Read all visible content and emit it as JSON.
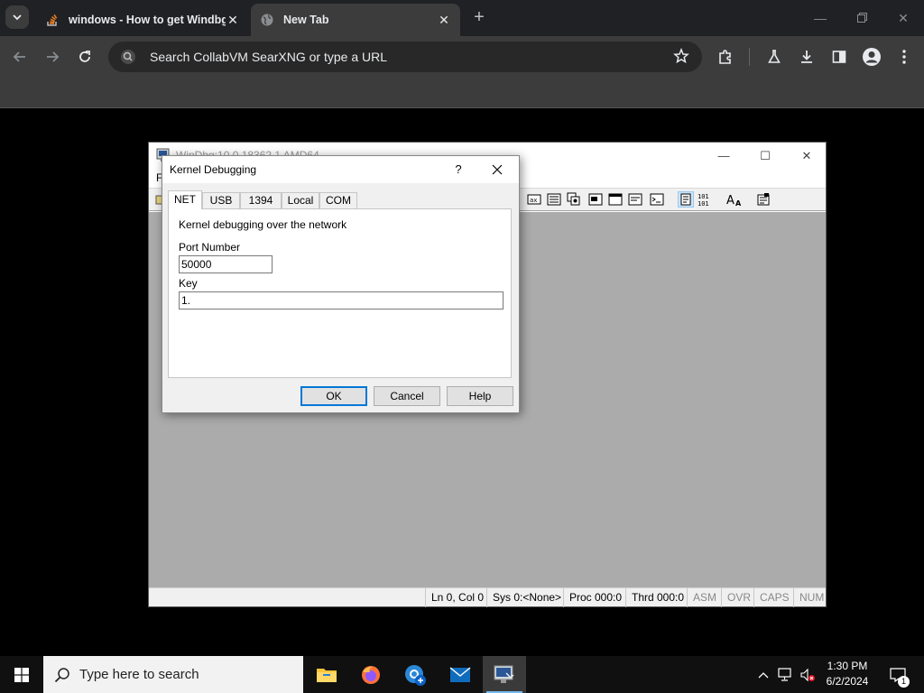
{
  "browser": {
    "tabs": [
      {
        "title": "windows - How to get Windbg",
        "favicon": "stackoverflow-icon",
        "active": false
      },
      {
        "title": "New Tab",
        "favicon": "globe-icon",
        "active": true
      }
    ],
    "address_placeholder": "Search CollabVM SearXNG or type a URL"
  },
  "windbg": {
    "title": "WinDbg:10.0.18362.1 AMD64",
    "menu_first": "Fi",
    "status": {
      "position": "Ln 0, Col 0",
      "sys": "Sys 0:<None>",
      "proc": "Proc 000:0",
      "thrd": "Thrd 000:0",
      "asm": "ASM",
      "ovr": "OVR",
      "caps": "CAPS",
      "num": "NUM"
    }
  },
  "dialog": {
    "title": "Kernel Debugging",
    "help_glyph": "?",
    "tabs": [
      "NET",
      "USB",
      "1394",
      "Local",
      "COM"
    ],
    "selected_tab": "NET",
    "description": "Kernel debugging over the network",
    "port_label": "Port Number",
    "port_value": "50000",
    "key_label": "Key",
    "key_value": "1.",
    "buttons": {
      "ok": "OK",
      "cancel": "Cancel",
      "help": "Help"
    }
  },
  "taskbar": {
    "search_placeholder": "Type here to search",
    "time": "1:30 PM",
    "date": "6/2/2024",
    "notification_count": "1"
  }
}
